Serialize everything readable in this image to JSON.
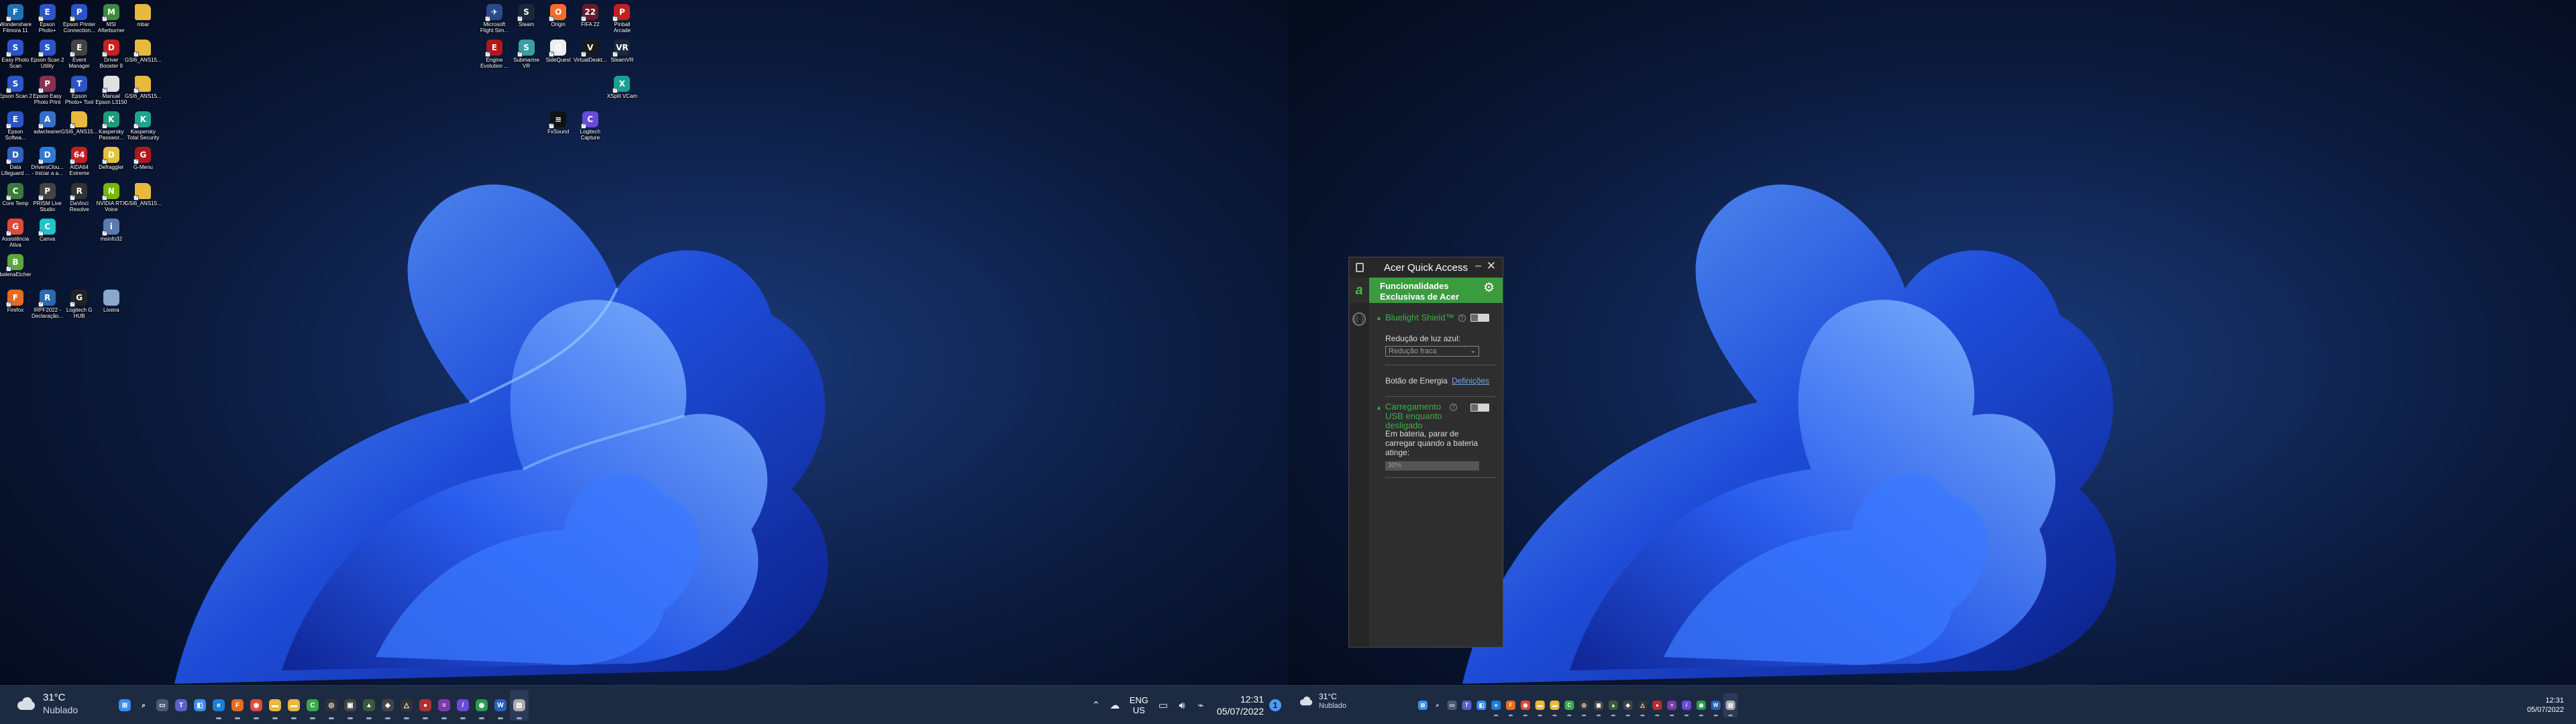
{
  "monitor1": {
    "desktop_icons": [
      {
        "label": "Wondershare\nFilmora 11",
        "icon": "filmora-icon",
        "color": "#1c73b8",
        "glyph": "F"
      },
      {
        "label": "Epson\nPhoto+",
        "icon": "epson-photo-icon",
        "color": "#2a55c8",
        "glyph": "E"
      },
      {
        "label": "Epson Printer\nConnection...",
        "icon": "epson-printer-icon",
        "color": "#2a55c8",
        "glyph": "P"
      },
      {
        "label": "MSI\nAfterburner",
        "icon": "afterburner-icon",
        "color": "#3e8a3a",
        "glyph": "M"
      },
      {
        "label": "mbar",
        "icon": "folder-icon",
        "color": "#e8b93a",
        "glyph": ""
      },
      {
        "label": "Easy Photo\nScan",
        "icon": "epson-scan-icon",
        "color": "#2a55c8",
        "glyph": "S"
      },
      {
        "label": "Epson Scan 2\nUtility",
        "icon": "epson-scan-utility-icon",
        "color": "#2a55c8",
        "glyph": "S"
      },
      {
        "label": "Event\nManager",
        "icon": "event-manager-icon",
        "color": "#444",
        "glyph": "E"
      },
      {
        "label": "Driver\nBooster 9",
        "icon": "driver-booster-icon",
        "color": "#c8201e",
        "glyph": "D"
      },
      {
        "label": "GSI6_ANS15...",
        "icon": "file-icon",
        "color": "#e8b93a",
        "glyph": ""
      },
      {
        "label": "Epson Scan 2",
        "icon": "epson-scan2-icon",
        "color": "#2a55c8",
        "glyph": "S"
      },
      {
        "label": "Epson Easy\nPhoto Print",
        "icon": "epson-easy-print-icon",
        "color": "#8a3050",
        "glyph": "P"
      },
      {
        "label": "Epson\nPhoto+ Tool",
        "icon": "epson-photo-tool-icon",
        "color": "#2a55c8",
        "glyph": "T"
      },
      {
        "label": "Manual\nEpson L3150",
        "icon": "manual-icon",
        "color": "#e0e0e0",
        "glyph": ""
      },
      {
        "label": "GSI6_ANS15...",
        "icon": "file-icon",
        "color": "#e8b93a",
        "glyph": ""
      },
      {
        "label": "Epson\nSoftwa...",
        "icon": "epson-software-icon",
        "color": "#2a55c8",
        "glyph": "E"
      },
      {
        "label": "adwcleaner",
        "icon": "adwcleaner-icon",
        "color": "#3570c8",
        "glyph": "A"
      },
      {
        "label": "GSI6_ANS15...",
        "icon": "file-icon",
        "color": "#e8b93a",
        "glyph": ""
      },
      {
        "label": "Kaspersky\nPasswor...",
        "icon": "kaspersky-password-icon",
        "color": "#1e9b7a",
        "glyph": "K"
      },
      {
        "label": "Kaspersky\nTotal Security",
        "icon": "kaspersky-icon",
        "color": "#1ea48c",
        "glyph": "K"
      },
      {
        "label": "Data\nLifeguard ...",
        "icon": "data-lifeguard-icon",
        "color": "#3060c0",
        "glyph": "D"
      },
      {
        "label": "DriversClou...\n- Iniciar a a...",
        "icon": "drivers-cloud-icon",
        "color": "#2f7ad8",
        "glyph": "D"
      },
      {
        "label": "AIDA64\nExtreme",
        "icon": "aida64-icon",
        "color": "#c82020",
        "glyph": "64"
      },
      {
        "label": "Defraggler",
        "icon": "defraggler-icon",
        "color": "#e8c040",
        "glyph": "D"
      },
      {
        "label": "G-Menu",
        "icon": "g-menu-icon",
        "color": "#b01818",
        "glyph": "G"
      },
      {
        "label": "Core Temp",
        "icon": "core-temp-icon",
        "color": "#3a7a3a",
        "glyph": "C"
      },
      {
        "label": "PRISM Live\nStudio",
        "icon": "prism-icon",
        "color": "#444",
        "glyph": "P"
      },
      {
        "label": "DaVinci\nResolve",
        "icon": "davinci-icon",
        "color": "#333",
        "glyph": "R"
      },
      {
        "label": "NVIDIA RTX\nVoice",
        "icon": "nvidia-icon",
        "color": "#76b900",
        "glyph": "N"
      },
      {
        "label": "GSI6_ANS15...",
        "icon": "file-icon",
        "color": "#e8b93a",
        "glyph": ""
      },
      {
        "label": "Assistência\nAtiva",
        "icon": "chrome-icon",
        "color": "#dd4b39",
        "glyph": "G"
      },
      {
        "label": "Canva",
        "icon": "canva-icon",
        "color": "#20c4cb",
        "glyph": "C"
      },
      {
        "label": "msinfo32",
        "icon": "msinfo-icon",
        "color": "#5a7ab0",
        "glyph": "i"
      },
      {
        "label": "balenaEtcher",
        "icon": "balena-icon",
        "color": "#5aa83c",
        "glyph": "B"
      },
      {
        "label": "Firefox",
        "icon": "firefox-icon",
        "color": "#e86a1e",
        "glyph": "F"
      },
      {
        "label": "IRPF2022 -\nDeclaração...",
        "icon": "irpf-icon",
        "color": "#2a6ab0",
        "glyph": "R"
      },
      {
        "label": "Logitech G\nHUB",
        "icon": "logitech-ghub-icon",
        "color": "#222",
        "glyph": "G"
      },
      {
        "label": "Lixeira",
        "icon": "recycle-bin-icon",
        "color": "#8aa8c8",
        "glyph": ""
      },
      {
        "label": "Microsoft\nFlight Sim...",
        "icon": "flight-sim-icon",
        "color": "#2a4a8a",
        "glyph": "✈"
      },
      {
        "label": "Steam",
        "icon": "steam-icon",
        "color": "#1b2838",
        "glyph": "S"
      },
      {
        "label": "Origin",
        "icon": "origin-icon",
        "color": "#f56c2d",
        "glyph": "O"
      },
      {
        "label": "FIFA 22",
        "icon": "fifa-icon",
        "color": "#6a1a2a",
        "glyph": "22"
      },
      {
        "label": "Pinball\nArcade",
        "icon": "pinball-icon",
        "color": "#c02020",
        "glyph": "P"
      },
      {
        "label": "Engine\nEvolution ...",
        "icon": "engine-evolution-icon",
        "color": "#b01818",
        "glyph": "E"
      },
      {
        "label": "Submarine\nVR",
        "icon": "submarine-icon",
        "color": "#3aa0a0",
        "glyph": "S"
      },
      {
        "label": "SideQuest",
        "icon": "sidequest-icon",
        "color": "#eee",
        "glyph": "Q"
      },
      {
        "label": "VirtualDeskt...",
        "icon": "virtual-desktop-icon",
        "color": "#1a1a1a",
        "glyph": "V"
      },
      {
        "label": "SteamVR",
        "icon": "steamvr-icon",
        "color": "#1b2838",
        "glyph": "VR"
      },
      {
        "label": "XSplit VCam",
        "icon": "xsplit-icon",
        "color": "#1aa090",
        "glyph": "X"
      },
      {
        "label": "FxSound",
        "icon": "fxsound-icon",
        "color": "#111",
        "glyph": "≡"
      },
      {
        "label": "Logitech\nCapture",
        "icon": "logitech-capture-icon",
        "color": "#6a4ad8",
        "glyph": "C"
      }
    ],
    "weather": {
      "temp": "31°C",
      "condition": "Nublado"
    },
    "taskbar_apps": [
      {
        "icon": "start-icon",
        "color": "#3a8ef0",
        "glyph": "⊞"
      },
      {
        "icon": "search-icon",
        "color": "transparent",
        "glyph": "⌕"
      },
      {
        "icon": "task-view-icon",
        "color": "#4a5a78",
        "glyph": "▭"
      },
      {
        "icon": "teams-chat-icon",
        "color": "#5b5fc7",
        "glyph": "T"
      },
      {
        "icon": "widgets-icon",
        "color": "#3a8ef0",
        "glyph": "◧"
      },
      {
        "icon": "edge-icon",
        "color": "#1b7fd4",
        "glyph": "e"
      },
      {
        "icon": "firefox-icon",
        "color": "#e86a1e",
        "glyph": "F"
      },
      {
        "icon": "chrome-icon",
        "color": "#dd4b39",
        "glyph": "◉"
      },
      {
        "icon": "file-explorer-icon",
        "color": "#e8b93a",
        "glyph": "▬"
      },
      {
        "icon": "folder-icon",
        "color": "#e8b93a",
        "glyph": "▬"
      },
      {
        "icon": "chat-app-icon",
        "color": "#3aa84a",
        "glyph": "C"
      },
      {
        "icon": "obs-icon",
        "color": "#333",
        "glyph": "◎"
      },
      {
        "icon": "photo-app-icon",
        "color": "#444",
        "glyph": "▣"
      },
      {
        "icon": "game-icon",
        "color": "#3a5a3a",
        "glyph": "▲"
      },
      {
        "icon": "editor-icon",
        "color": "#444",
        "glyph": "◆"
      },
      {
        "icon": "app-icon",
        "color": "#333",
        "glyph": "△"
      },
      {
        "icon": "record-icon",
        "color": "#b03030",
        "glyph": "●"
      },
      {
        "icon": "tool-icon",
        "color": "#7a3aa8",
        "glyph": "≡"
      },
      {
        "icon": "paint-icon",
        "color": "#6a4ad8",
        "glyph": "/"
      },
      {
        "icon": "chrome-icon",
        "color": "#2a9a4a",
        "glyph": "◉"
      },
      {
        "icon": "word-icon",
        "color": "#2b5fb8",
        "glyph": "W"
      },
      {
        "icon": "acer-quick-access-icon",
        "color": "#aaa",
        "glyph": "▤"
      }
    ],
    "tray": {
      "lang1": "ENG",
      "lang2": "US",
      "time": "12:31",
      "date": "05/07/2022",
      "notification": "1"
    }
  },
  "monitor2": {
    "weather": {
      "temp": "31°C",
      "condition": "Nublado"
    },
    "tray": {
      "time": "12:31",
      "date": "05/07/2022"
    }
  },
  "aqa": {
    "title": "Acer Quick Access",
    "header": "Funcionalidades Exclusivas de Acer",
    "bluelight_label": "Bluelight Shield™",
    "blue_reduction_label": "Redução de luz azul:",
    "blue_reduction_value": "Redução fraca",
    "power_button_label": "Botão de Energia",
    "power_button_link": "Definições",
    "usb_label": "Carregamento USB enquanto desligado",
    "battery_label": "Em bateria, parar de carregar quando a bateria atinge:",
    "battery_value": "30%"
  }
}
